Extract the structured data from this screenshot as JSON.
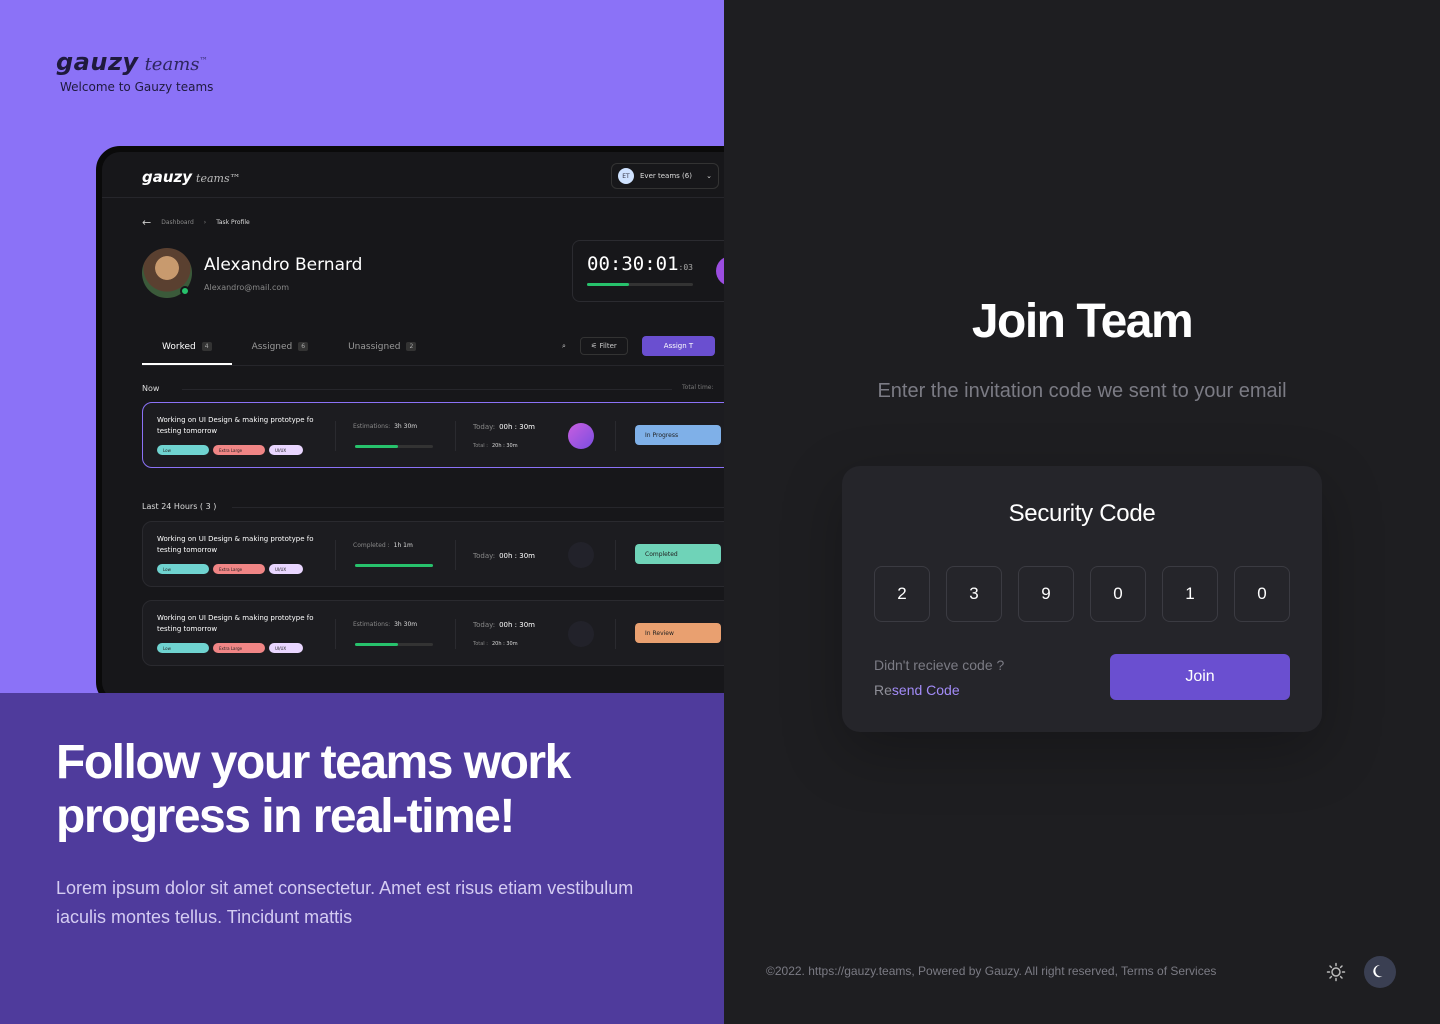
{
  "brand": {
    "name_bold": "gauzy",
    "name_light": "teams",
    "trademark": "™",
    "tagline": "Welcome to Gauzy teams"
  },
  "preview": {
    "logo_bold": "gauzy",
    "logo_light": "teams™",
    "team_initials": "ET",
    "team_select": "Ever teams (6)",
    "breadcrumb": [
      "Dashboard",
      "Task Profile"
    ],
    "profile_name": "Alexandro Bernard",
    "profile_email": "Alexandro@mail.com",
    "timer_main": "00:30:01",
    "timer_ms": ":03",
    "timer_progress": 0.4,
    "tabs": [
      {
        "label": "Worked",
        "count": "4"
      },
      {
        "label": "Assigned",
        "count": "6"
      },
      {
        "label": "Unassigned",
        "count": "2"
      }
    ],
    "filter_label": "Filter",
    "assign_label": "Assign T",
    "now_label": "Now",
    "total_time_label": "Total time:",
    "last24_label": "Last 24 Hours ( 3 )",
    "tasks": [
      {
        "title": "Working on UI Design & making prototype fo testing tomorrow",
        "tags": [
          "Low",
          "Extra Large",
          "UI/UX"
        ],
        "est_label": "Estimations:",
        "est_value": "3h 30m",
        "progress": 0.55,
        "today_label": "Today:",
        "today_value": "00h : 30m",
        "total_label": "Total :",
        "total_value": "20h : 30m",
        "status": "In Progress",
        "status_color": "#7fb0e8"
      },
      {
        "title": "Working on UI Design & making prototype fo testing tomorrow",
        "tags": [
          "Low",
          "Extra Large",
          "UI/UX"
        ],
        "est_label": "Completed :",
        "est_value": "1h 1m",
        "progress": 1.0,
        "today_label": "Today:",
        "today_value": "00h : 30m",
        "total_label": "",
        "total_value": "",
        "status": "Completed",
        "status_color": "#6fd3b8"
      },
      {
        "title": "Working on UI Design & making prototype fo testing tomorrow",
        "tags": [
          "Low",
          "Extra Large",
          "UI/UX"
        ],
        "est_label": "Estimations:",
        "est_value": "3h 30m",
        "progress": 0.55,
        "today_label": "Today:",
        "today_value": "00h : 30m",
        "total_label": "Total :",
        "total_value": "20h : 30m",
        "status": "In Review",
        "status_color": "#e9a070"
      }
    ]
  },
  "promo": {
    "heading": "Follow your teams work progress in real-time!",
    "body": "Lorem ipsum dolor sit amet consectetur. Amet est risus etiam vestibulum iaculis montes tellus. Tincidunt mattis"
  },
  "join": {
    "title": "Join Team",
    "subtitle": "Enter the invitation code we sent to your email",
    "card_title": "Security Code",
    "digits": [
      "2",
      "3",
      "9",
      "0",
      "1",
      "0"
    ],
    "resend_question": "Didn't recieve code ?",
    "resend_prefix": "Re",
    "resend_link": "send Code",
    "join_button": "Join"
  },
  "footer": {
    "text": "©2022. https://gauzy.teams, Powered by Gauzy. All right reserved, Terms of Services"
  },
  "theme": {
    "light_icon": "sun-icon",
    "dark_icon": "moon-icon",
    "active": "dark"
  },
  "colors": {
    "accent": "#6a4fd0",
    "left_top": "#8b72f7",
    "left_bottom": "#4f3b9c",
    "right_bg": "#1e1e21"
  }
}
